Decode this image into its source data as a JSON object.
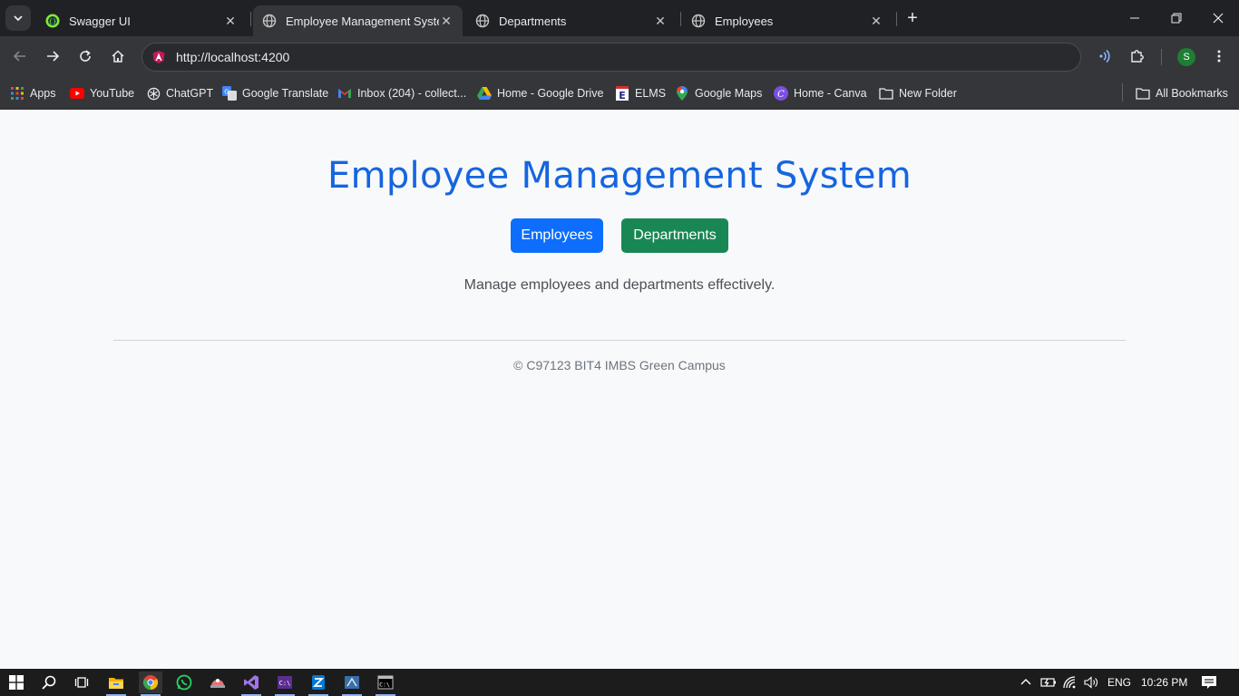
{
  "browser": {
    "tabs": [
      {
        "title": "Swagger UI",
        "icon": "swagger-icon"
      },
      {
        "title": "Employee Management System",
        "icon": "globe-icon",
        "active": true
      },
      {
        "title": "Departments",
        "icon": "globe-icon"
      },
      {
        "title": "Employees",
        "icon": "globe-icon"
      }
    ],
    "close_glyph": "✕",
    "new_tab_glyph": "+",
    "url": "http://localhost:4200",
    "profile_initial": "S",
    "bookmarks": [
      {
        "label": "Apps",
        "icon": "apps-grid-icon"
      },
      {
        "label": "YouTube",
        "icon": "youtube-icon"
      },
      {
        "label": "ChatGPT",
        "icon": "chatgpt-icon"
      },
      {
        "label": "Google Translate",
        "icon": "google-translate-icon"
      },
      {
        "label": "Inbox (204) - collect...",
        "icon": "gmail-icon"
      },
      {
        "label": "Home - Google Drive",
        "icon": "google-drive-icon"
      },
      {
        "label": "ELMS",
        "icon": "elms-icon"
      },
      {
        "label": "Google Maps",
        "icon": "google-maps-icon"
      },
      {
        "label": "Home - Canva",
        "icon": "canva-icon"
      },
      {
        "label": "New Folder",
        "icon": "folder-icon"
      }
    ],
    "all_bookmarks": "All Bookmarks"
  },
  "page": {
    "title": "Employee Management System",
    "buttons": {
      "employees": "Employees",
      "departments": "Departments"
    },
    "lead": "Manage employees and departments effectively.",
    "footer": "© C97123 BIT4 IMBS Green Campus"
  },
  "taskbar": {
    "language": "ENG",
    "time": "10:26 PM"
  },
  "colors": {
    "primary": "#0d6efd",
    "success": "#198754",
    "title": "#1565e0"
  }
}
